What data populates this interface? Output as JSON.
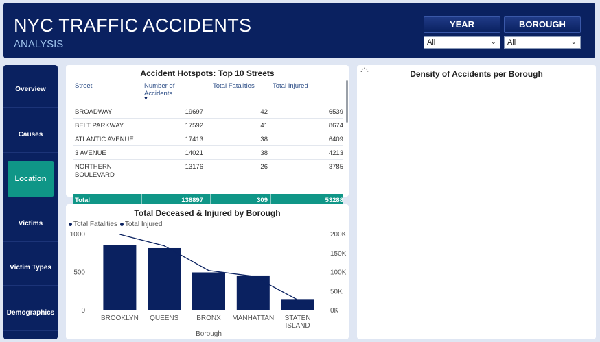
{
  "header": {
    "title": "NYC TRAFFIC ACCIDENTS",
    "subtitle": "ANALYSIS",
    "filters": [
      {
        "label": "YEAR",
        "value": "All"
      },
      {
        "label": "BOROUGH",
        "value": "All"
      }
    ]
  },
  "sidebar": {
    "items": [
      {
        "label": "Overview",
        "active": false
      },
      {
        "label": "Causes",
        "active": false
      },
      {
        "label": "Location",
        "active": true
      },
      {
        "label": "Victims",
        "active": false
      },
      {
        "label": "Victim Types",
        "active": false
      },
      {
        "label": "Demographics",
        "active": false
      }
    ]
  },
  "hotspots": {
    "title": "Accident Hotspots: Top 10 Streets",
    "columns": [
      "Street",
      "Number of Accidents",
      "Total Fatalities",
      "Total Injured"
    ],
    "rows": [
      {
        "street": "BROADWAY",
        "accidents": "19697",
        "fatalities": "42",
        "injured": "6539"
      },
      {
        "street": "BELT PARKWAY",
        "accidents": "17592",
        "fatalities": "41",
        "injured": "8674"
      },
      {
        "street": "ATLANTIC AVENUE",
        "accidents": "17413",
        "fatalities": "38",
        "injured": "6409"
      },
      {
        "street": "3 AVENUE",
        "accidents": "14021",
        "fatalities": "38",
        "injured": "4213"
      },
      {
        "street": "NORTHERN BOULEVARD",
        "accidents": "13176",
        "fatalities": "26",
        "injured": "3785"
      }
    ],
    "total": {
      "label": "Total",
      "accidents": "138897",
      "fatalities": "309",
      "injured": "53288"
    }
  },
  "density": {
    "title": "Density of Accidents per Borough"
  },
  "chart_data": {
    "type": "bar",
    "title": "Total Deceased & Injured by Borough",
    "xlabel": "Borough",
    "categories": [
      "BROOKLYN",
      "QUEENS",
      "BRONX",
      "MANHATTAN",
      "STATEN ISLAND"
    ],
    "series": [
      {
        "name": "Total Fatalities",
        "type": "bar",
        "axis": "left",
        "values": [
          860,
          820,
          500,
          460,
          150
        ],
        "color": "#0a2160"
      },
      {
        "name": "Total Injured",
        "type": "line",
        "axis": "right",
        "values": [
          200000,
          170000,
          105000,
          90000,
          28000
        ],
        "color": "#0a2160"
      }
    ],
    "left_axis": {
      "ticks": [
        "1000",
        "500",
        "0"
      ],
      "ylim": [
        0,
        1000
      ]
    },
    "right_axis": {
      "ticks": [
        "200K",
        "150K",
        "100K",
        "50K",
        "0K"
      ],
      "ylim": [
        0,
        200000
      ]
    },
    "legend_position": "top-left",
    "grid": false
  }
}
